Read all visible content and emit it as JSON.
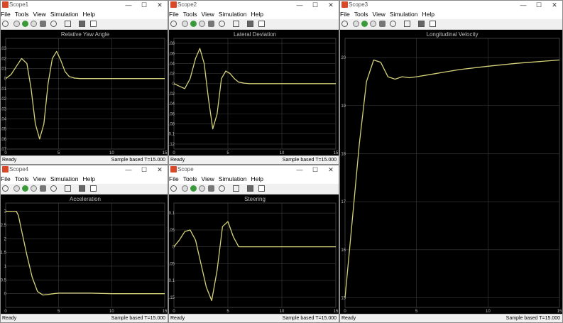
{
  "menu": [
    "File",
    "Tools",
    "View",
    "Simulation",
    "Help"
  ],
  "icons": [
    "settings-icon",
    "step-back-icon",
    "run-icon",
    "step-forward-icon",
    "stop-icon",
    "zoom-icon",
    "fit-to-view-icon",
    "triggers-icon",
    "style-icon"
  ],
  "colors": {
    "trace": "#d4d07a",
    "plot_bg": "#000000",
    "grid": "#3c3c3c"
  },
  "window_controls": {
    "minimize": "—",
    "maximize": "☐",
    "close": "✕"
  },
  "windows": [
    {
      "id": "scope1",
      "title": "Scope1",
      "plot_title": "Relative Yaw Angle",
      "status_left": "Ready",
      "status_right": "Sample based  T=15.000",
      "chart_data": {
        "type": "line",
        "title": "Relative Yaw Angle",
        "xlim": [
          0,
          15
        ],
        "ylim": [
          -0.07,
          0.04
        ],
        "xticks": [
          "0",
          "5",
          "10",
          "15"
        ],
        "yticks": [
          "0.03",
          "0.02",
          "0.01",
          "0",
          "-0.01",
          "-0.02",
          "-0.03",
          "-0.04",
          "-0.05",
          "-0.06",
          "-0.07"
        ],
        "grid": true,
        "x": [
          0,
          0.5,
          1,
          1.5,
          2,
          2.4,
          2.8,
          3.2,
          3.6,
          4,
          4.4,
          4.8,
          5.2,
          5.6,
          6,
          6.5,
          7,
          8,
          10,
          12,
          15
        ],
        "y": [
          0,
          0.004,
          0.012,
          0.02,
          0.015,
          -0.01,
          -0.045,
          -0.06,
          -0.045,
          -0.005,
          0.02,
          0.027,
          0.018,
          0.007,
          0.002,
          0.0005,
          0,
          0,
          0,
          0,
          0
        ]
      }
    },
    {
      "id": "scope2",
      "title": "Scope2",
      "plot_title": "Lateral Deviation",
      "status_left": "Ready",
      "status_right": "Sample based  T=15.000",
      "chart_data": {
        "type": "line",
        "title": "Lateral Deviation",
        "xlim": [
          0,
          15
        ],
        "ylim": [
          -0.13,
          0.09
        ],
        "xticks": [
          "0",
          "5",
          "10",
          "15"
        ],
        "yticks": [
          "0.08",
          "0.06",
          "0.04",
          "0.02",
          "0",
          "-0.02",
          "-0.04",
          "-0.06",
          "-0.08",
          "-0.1",
          "-0.12"
        ],
        "grid": true,
        "x": [
          0,
          0.5,
          1,
          1.5,
          2,
          2.4,
          2.8,
          3.2,
          3.6,
          4,
          4.4,
          4.8,
          5.2,
          5.6,
          6,
          6.5,
          7,
          8,
          10,
          12,
          15
        ],
        "y": [
          0,
          -0.005,
          -0.01,
          0.01,
          0.05,
          0.07,
          0.04,
          -0.03,
          -0.09,
          -0.06,
          0.01,
          0.025,
          0.02,
          0.01,
          0.003,
          0.001,
          0,
          0,
          0,
          0,
          0
        ]
      }
    },
    {
      "id": "scope3",
      "title": "Scope3",
      "plot_title": "Longitudinal Velocity",
      "status_left": "Ready",
      "status_right": "Sample based  T=15.000",
      "chart_data": {
        "type": "line",
        "title": "Longitudinal Velocity",
        "xlim": [
          0,
          15
        ],
        "ylim": [
          14.8,
          20.4
        ],
        "xticks": [
          "0",
          "5",
          "10",
          "15"
        ],
        "yticks": [
          "20",
          "19",
          "18",
          "17",
          "16",
          "15"
        ],
        "grid": true,
        "x": [
          0,
          0.5,
          1,
          1.5,
          2,
          2.5,
          3,
          3.5,
          4,
          4.5,
          5,
          6,
          7,
          8,
          10,
          12,
          15
        ],
        "y": [
          15,
          16.6,
          18.2,
          19.5,
          19.95,
          19.9,
          19.6,
          19.55,
          19.6,
          19.58,
          19.6,
          19.65,
          19.7,
          19.75,
          19.82,
          19.88,
          19.95
        ]
      }
    },
    {
      "id": "scope4",
      "title": "Scope4",
      "plot_title": "Acceleration",
      "status_left": "Ready",
      "status_right": "Sample based  T=15.000",
      "chart_data": {
        "type": "line",
        "title": "Acceleration",
        "xlim": [
          0,
          15
        ],
        "ylim": [
          -0.5,
          3.3
        ],
        "xticks": [
          "0",
          "5",
          "10",
          "15"
        ],
        "yticks": [
          "3",
          "2.5",
          "2",
          "1.5",
          "1",
          "0.5",
          "0"
        ],
        "grid": true,
        "x": [
          0,
          1,
          1.2,
          1.5,
          2,
          2.5,
          3,
          3.5,
          4,
          4.5,
          5,
          6,
          8,
          10,
          12,
          15
        ],
        "y": [
          3,
          3,
          2.85,
          2.3,
          1.4,
          0.6,
          0.08,
          -0.05,
          -0.03,
          0,
          0.02,
          0.02,
          0.02,
          0,
          0,
          0
        ]
      }
    },
    {
      "id": "scope",
      "title": "Scope",
      "plot_title": "Steering",
      "status_left": "Ready",
      "status_right": "Sample based  T=15.000",
      "chart_data": {
        "type": "line",
        "title": "Steering",
        "xlim": [
          0,
          15
        ],
        "ylim": [
          -0.18,
          0.13
        ],
        "xticks": [
          "0",
          "5",
          "10",
          "15"
        ],
        "yticks": [
          "0.1",
          "0.05",
          "0",
          "-0.05",
          "-0.1",
          "-0.15"
        ],
        "grid": true,
        "x": [
          0,
          0.5,
          1,
          1.5,
          2,
          2.5,
          3,
          3.5,
          4,
          4.5,
          5,
          5.5,
          6,
          7,
          8,
          10,
          12,
          15
        ],
        "y": [
          0,
          0.02,
          0.045,
          0.05,
          0.02,
          -0.05,
          -0.12,
          -0.16,
          -0.07,
          0.06,
          0.075,
          0.03,
          0,
          0,
          0,
          0,
          0,
          0
        ]
      }
    }
  ]
}
